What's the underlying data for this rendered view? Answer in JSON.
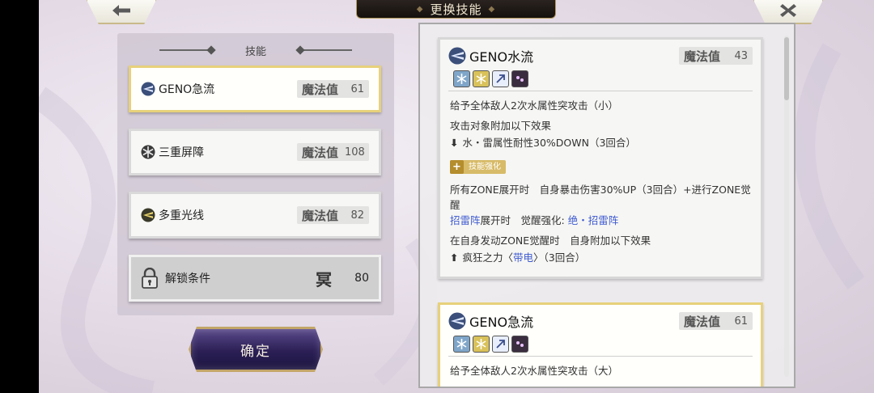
{
  "header": {
    "title": "更换技能"
  },
  "left_panel": {
    "heading": "技能",
    "slots": [
      {
        "name": "GENO急流",
        "mp_label": "魔法值",
        "mp_value": "61",
        "icon": "water-blade-icon",
        "selected": true
      },
      {
        "name": "三重屏障",
        "mp_label": "魔法值",
        "mp_value": "108",
        "icon": "snowflake-barrier-icon",
        "selected": false
      },
      {
        "name": "多重光线",
        "mp_label": "魔法值",
        "mp_value": "82",
        "icon": "light-beam-icon",
        "selected": false
      }
    ],
    "locked_slot": {
      "label": "解锁条件",
      "icon": "padlock-icon",
      "glyph": "冥",
      "value": "80"
    }
  },
  "confirm_label": "确定",
  "right_panel": {
    "cards": [
      {
        "name": "GENO水流",
        "mp_label": "魔法值",
        "mp_value": "43",
        "icon": "water-blade-icon",
        "tags": [
          "water-attribute-icon",
          "thunder-attribute-icon",
          "wind-attribute-icon",
          "dark-attribute-icon"
        ],
        "desc1": "给予全体敌人2次水属性突攻击（小）",
        "desc2": "攻击对象附加以下效果",
        "effect_down": "水・雷属性耐性30%DOWN（3回合）",
        "enhance_label": "技能强化",
        "zone_text": "所有ZONE展开时　自身暴击伤害30%UP（3回合）+进行ZONE觉醒",
        "zone2_link": "招雷阵",
        "zone2_text": "展开时　觉醒强化:",
        "zone2_link2": "绝・招雷阵",
        "awaken_text": "在自身发动ZONE觉醒时　自身附加以下效果",
        "effect_up_prefix": "疯狂之力〈",
        "effect_up_link": "带电",
        "effect_up_suffix": "〉（3回合）"
      },
      {
        "name": "GENO急流",
        "mp_label": "魔法值",
        "mp_value": "61",
        "icon": "water-blade-icon",
        "tags": [
          "water-attribute-icon",
          "thunder-attribute-icon",
          "wind-attribute-icon",
          "dark-attribute-icon"
        ],
        "desc1": "给予全体敌人2次水属性突攻击（大）"
      }
    ]
  },
  "colors": {
    "selected_border": "#e7d17b",
    "link": "#3f5bd0",
    "confirm_bg": "#2b1f55",
    "gold_trim": "#c3a668"
  }
}
